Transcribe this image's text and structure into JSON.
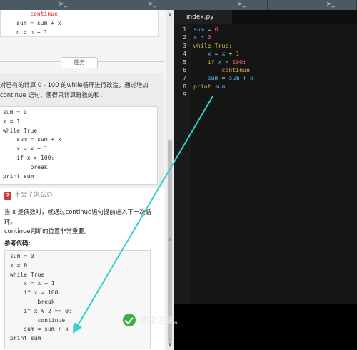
{
  "top_tabs": [
    {
      "label": ">_"
    },
    {
      "label": ">_"
    },
    {
      "label": ">_"
    },
    {
      "label": ">_"
    }
  ],
  "top_code_box": {
    "lines": [
      "    continue",
      "sum = sum + x",
      "n = n + 1"
    ]
  },
  "task_tab": {
    "label": "任务"
  },
  "task_description": "对已有的计算 0 - 100 的while循环进行改造，通过增加 continue 语句，使得只计算奇数的和：",
  "task_code": [
    "sum = 0",
    "x = 1",
    "while True:",
    "    sum = sum + x",
    "    x = x + 1",
    "    if x > 100:",
    "        break",
    "print sum"
  ],
  "hint": {
    "title": "不会了怎么办",
    "paragraph1": "当 x 是偶数时，就通过continue语句提前进入下一次循环。",
    "paragraph2": "continue判断的位置非常重要。",
    "ref_label": "参考代码:",
    "ref_code": [
      "sum = 0",
      "x = 0",
      "while True:",
      "    x = x + 1",
      "    if x > 100:",
      "        break",
      "    if x % 2 == 0:",
      "        continue",
      "    sum = sum + x",
      "print sum"
    ]
  },
  "editor": {
    "tab_label": "index.py",
    "line_numbers": [
      "1",
      "2",
      "3",
      "4",
      "5",
      "6",
      "7",
      "8"
    ],
    "lines": [
      [
        {
          "t": "sum",
          "c": "vr"
        },
        {
          "t": " = ",
          "c": "op"
        },
        {
          "t": "0",
          "c": "nm"
        }
      ],
      [
        {
          "t": "x",
          "c": "vr"
        },
        {
          "t": " = ",
          "c": "op"
        },
        {
          "t": "0",
          "c": "nm"
        }
      ],
      [
        {
          "t": "while",
          "c": "kw"
        },
        {
          "t": " ",
          "c": "op"
        },
        {
          "t": "True",
          "c": "kw"
        },
        {
          "t": ":",
          "c": "op"
        }
      ],
      [
        {
          "t": "    x",
          "c": "vr"
        },
        {
          "t": " = ",
          "c": "op"
        },
        {
          "t": "x",
          "c": "vr"
        },
        {
          "t": " + ",
          "c": "op"
        },
        {
          "t": "1",
          "c": "nm"
        }
      ],
      [
        {
          "t": "    if",
          "c": "kw"
        },
        {
          "t": " x ",
          "c": "vr"
        },
        {
          "t": "> ",
          "c": "op"
        },
        {
          "t": "100",
          "c": "nm"
        },
        {
          "t": ":",
          "c": "op"
        }
      ],
      [
        {
          "t": "        continue",
          "c": "kw"
        }
      ],
      [
        {
          "t": "    sum",
          "c": "vr"
        },
        {
          "t": " = ",
          "c": "op"
        },
        {
          "t": "sum",
          "c": "vr"
        },
        {
          "t": " + ",
          "c": "op"
        },
        {
          "t": "x",
          "c": "vr"
        }
      ],
      [
        {
          "t": "print",
          "c": "kw"
        },
        {
          "t": " sum",
          "c": "vr"
        }
      ]
    ]
  },
  "result": {
    "text": "提交正确。",
    "color": "#3fae49"
  },
  "colors": {
    "annotation_arrow": "#2ed3c8"
  }
}
